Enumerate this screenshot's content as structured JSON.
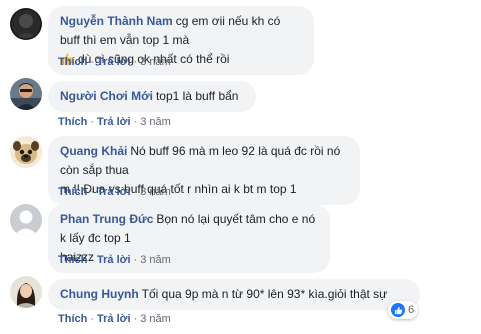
{
  "comments": [
    {
      "author": "Nguyễn Thành Nam",
      "line1": "cg em ơii nếu kh có buff thì em vẫn top 1 mà",
      "line2": "dù gì cũng ok nhất có thể rồi",
      "avatar_icon": "avatar-dark-circle-icon"
    },
    {
      "author": "Người Chơi Mới",
      "line1": "top1 là buff bẩn",
      "avatar_icon": "avatar-sunglasses-man-icon"
    },
    {
      "author": "Quang Khải",
      "line1": "Nó buff 96 mà m leo 92 là quá đc rồi nó còn sắp thua",
      "line2": "m !! Đua vs buff quá tốt r nhìn ai k bt m top 1",
      "avatar_icon": "avatar-pug-dog-icon"
    },
    {
      "author": "Phan Trung Đức",
      "line1": "Bọn nó lại quyết tâm cho e nó k lấy đc top 1",
      "line2": "haizzz",
      "avatar_icon": "avatar-default-silhouette-icon"
    },
    {
      "author": "Chung Huynh",
      "line1": "Tối qua 9p mà n từ 90* lên 93* kìa.giỏi thật sự",
      "avatar_icon": "avatar-woman-photo-icon"
    }
  ],
  "actions": {
    "like": "Thích",
    "reply": "Trả lời",
    "time": "3 năm",
    "separator": "·"
  },
  "reaction": {
    "icon": "like-thumb-icon",
    "count": "6"
  },
  "colors": {
    "author": "#385898",
    "bubble": "#f2f3f5",
    "meta": "#606770",
    "like_blue": "#1877f2"
  }
}
